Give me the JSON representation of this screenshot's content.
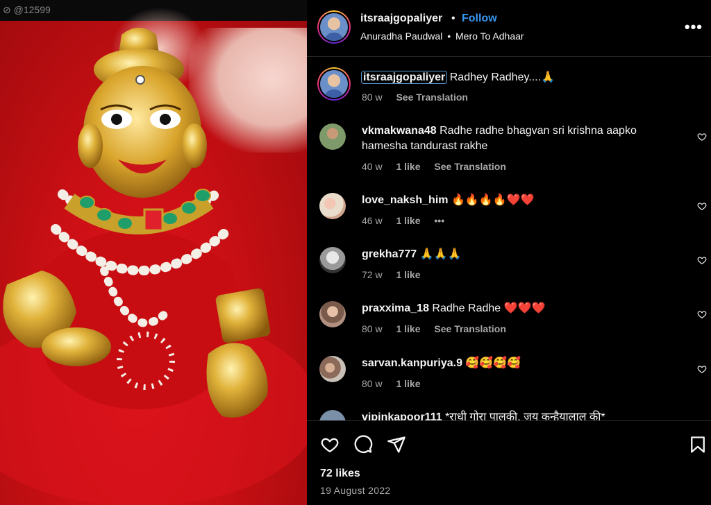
{
  "post": {
    "author": "itsraajgopaliyer",
    "follow_label": "Follow",
    "separator": "•",
    "audio_artist": "Anuradha Paudwal",
    "audio_title": "Mero To Adhaar",
    "more_label": "•••",
    "caption": {
      "username": "itsraajgopaliyer",
      "text": "Radhey Radhey....🙏",
      "time": "80 w",
      "see_translation": "See Translation"
    },
    "likes": "72 likes",
    "date": "19 August 2022",
    "media_watermark": "⊘ @12599"
  },
  "comments": [
    {
      "username": "vkmakwana48",
      "text": "Radhe radhe bhagvan sri krishna aapko hamesha tandurast rakhe",
      "time": "40 w",
      "likes": "1 like",
      "extra": "See Translation"
    },
    {
      "username": "love_naksh_him",
      "text": "🔥🔥🔥🔥❤️❤️",
      "time": "46 w",
      "likes": "1 like",
      "extra": "•••"
    },
    {
      "username": "grekha777",
      "text": "🙏🙏🙏",
      "time": "72 w",
      "likes": "1 like",
      "extra": ""
    },
    {
      "username": "praxxima_18",
      "text": "Radhe Radhe ❤️❤️❤️",
      "time": "80 w",
      "likes": "1 like",
      "extra": "See Translation"
    },
    {
      "username": "sarvan.kanpuriya.9",
      "text": "🥰🥰🥰🥰",
      "time": "80 w",
      "likes": "1 like",
      "extra": ""
    },
    {
      "username": "vipinkapoor111",
      "text": "*राधी गोरा पालकी, जय कन्हैयालाल की*",
      "time": "",
      "likes": "",
      "extra": ""
    }
  ],
  "icons": {
    "like": "heart-icon",
    "comment": "comment-icon",
    "share": "paper-plane-icon",
    "save": "bookmark-icon",
    "comment_like": "heart-icon",
    "more": "more-icon"
  },
  "colors": {
    "background": "#000000",
    "link": "#3897f0",
    "secondary_text": "#a8a8a8",
    "divider": "#262626",
    "media_red": "#c70f14"
  }
}
